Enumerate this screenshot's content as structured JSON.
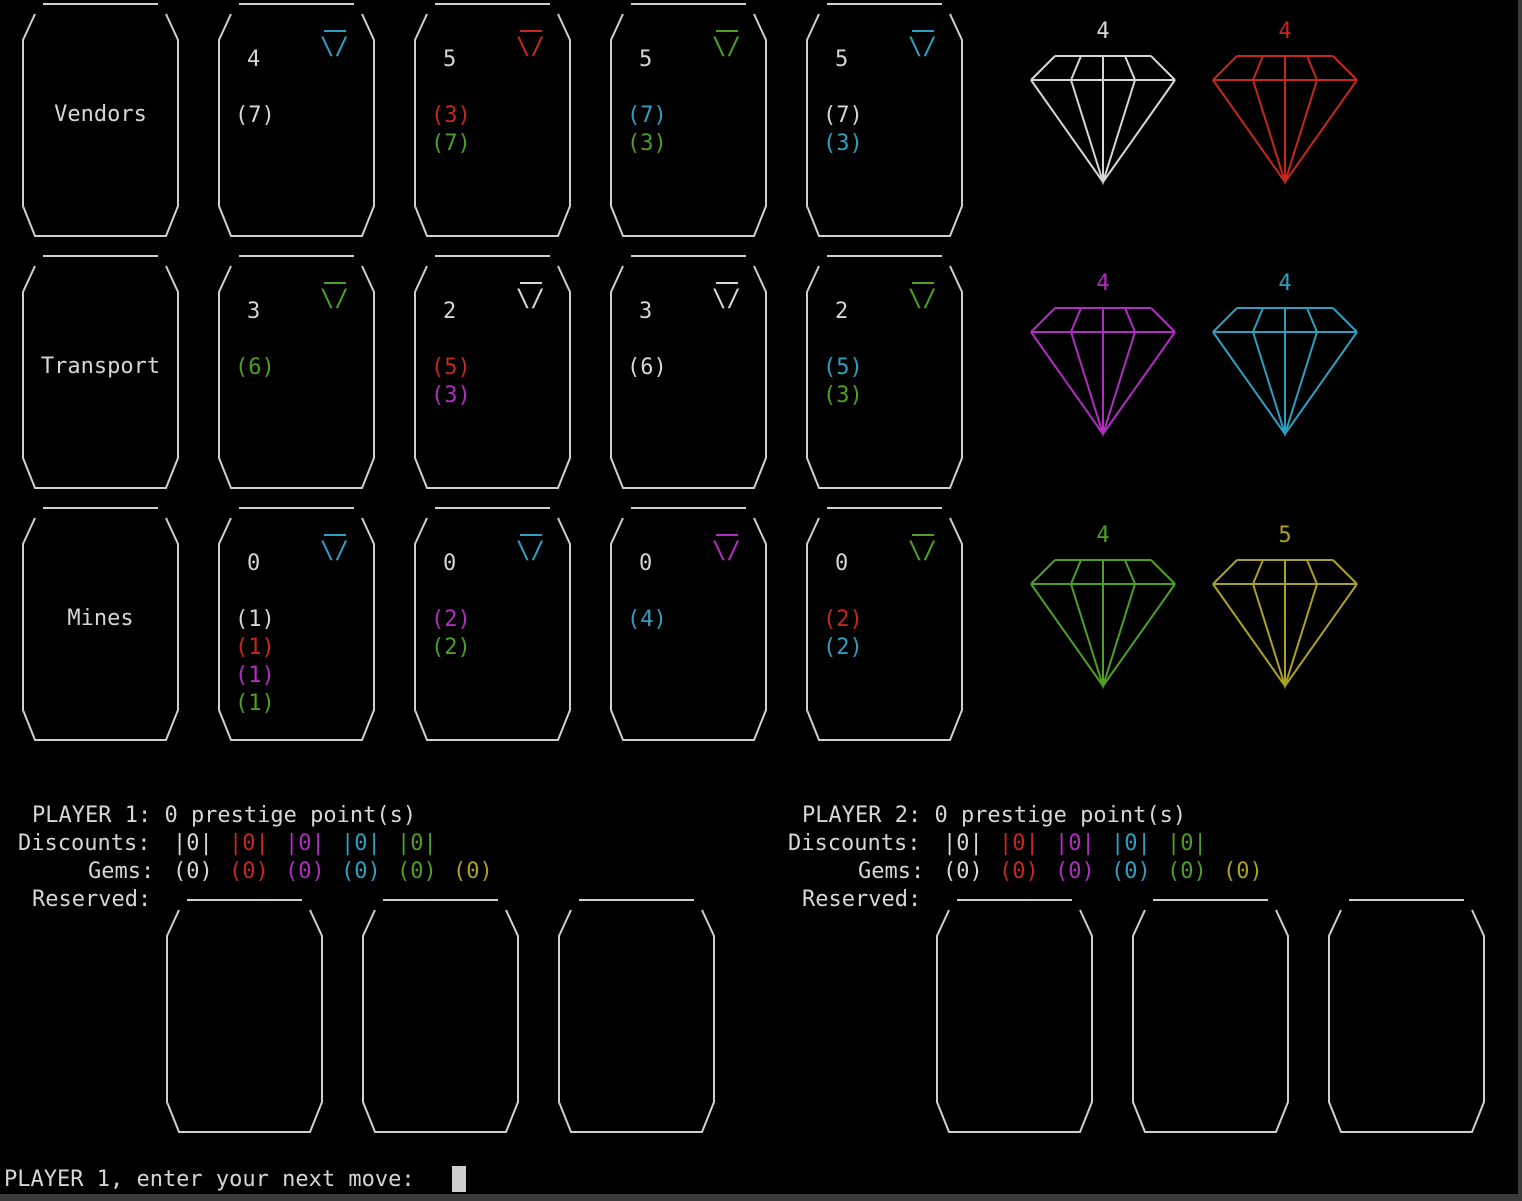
{
  "colors": {
    "white": "#d6d6d6",
    "red": "#c4281f",
    "purple": "#b12dc1",
    "cyan": "#2f9fc0",
    "green": "#4d9f25",
    "yellow": "#aaa126"
  },
  "rows": [
    {
      "label": "Vendors",
      "cards": [
        {
          "points": "4",
          "gem": "cyan",
          "costs": [
            {
              "value": "(7)",
              "color": "white"
            }
          ]
        },
        {
          "points": "5",
          "gem": "red",
          "costs": [
            {
              "value": "(3)",
              "color": "red"
            },
            {
              "value": "(7)",
              "color": "green"
            }
          ]
        },
        {
          "points": "5",
          "gem": "green",
          "costs": [
            {
              "value": "(7)",
              "color": "cyan"
            },
            {
              "value": "(3)",
              "color": "green"
            }
          ]
        },
        {
          "points": "5",
          "gem": "cyan",
          "costs": [
            {
              "value": "(7)",
              "color": "white"
            },
            {
              "value": "(3)",
              "color": "cyan"
            }
          ]
        }
      ]
    },
    {
      "label": "Transport",
      "cards": [
        {
          "points": "3",
          "gem": "green",
          "costs": [
            {
              "value": "(6)",
              "color": "green"
            }
          ]
        },
        {
          "points": "2",
          "gem": "white",
          "costs": [
            {
              "value": "(5)",
              "color": "red"
            },
            {
              "value": "(3)",
              "color": "purple"
            }
          ]
        },
        {
          "points": "3",
          "gem": "white",
          "costs": [
            {
              "value": "(6)",
              "color": "white"
            }
          ]
        },
        {
          "points": "2",
          "gem": "green",
          "costs": [
            {
              "value": "(5)",
              "color": "cyan"
            },
            {
              "value": "(3)",
              "color": "green"
            }
          ]
        }
      ]
    },
    {
      "label": "Mines",
      "cards": [
        {
          "points": "0",
          "gem": "cyan",
          "costs": [
            {
              "value": "(1)",
              "color": "white"
            },
            {
              "value": "(1)",
              "color": "red"
            },
            {
              "value": "(1)",
              "color": "purple"
            },
            {
              "value": "(1)",
              "color": "green"
            }
          ]
        },
        {
          "points": "0",
          "gem": "cyan",
          "costs": [
            {
              "value": "(2)",
              "color": "purple"
            },
            {
              "value": "(2)",
              "color": "green"
            }
          ]
        },
        {
          "points": "0",
          "gem": "purple",
          "costs": [
            {
              "value": "(4)",
              "color": "cyan"
            }
          ]
        },
        {
          "points": "0",
          "gem": "green",
          "costs": [
            {
              "value": "(2)",
              "color": "red"
            },
            {
              "value": "(2)",
              "color": "cyan"
            }
          ]
        }
      ]
    }
  ],
  "gem_bank": [
    {
      "count": "4",
      "color": "white"
    },
    {
      "count": "4",
      "color": "red"
    },
    {
      "count": "4",
      "color": "purple"
    },
    {
      "count": "4",
      "color": "cyan"
    },
    {
      "count": "4",
      "color": "green"
    },
    {
      "count": "5",
      "color": "yellow"
    }
  ],
  "players": [
    {
      "title": "PLAYER 1: 0 prestige point(s)",
      "discounts_label": "Discounts:",
      "discounts": [
        {
          "value": "|0|",
          "color": "white"
        },
        {
          "value": "|0|",
          "color": "red"
        },
        {
          "value": "|0|",
          "color": "purple"
        },
        {
          "value": "|0|",
          "color": "cyan"
        },
        {
          "value": "|0|",
          "color": "green"
        }
      ],
      "gems_label": "Gems:",
      "gems": [
        {
          "value": "(0)",
          "color": "white"
        },
        {
          "value": "(0)",
          "color": "red"
        },
        {
          "value": "(0)",
          "color": "purple"
        },
        {
          "value": "(0)",
          "color": "cyan"
        },
        {
          "value": "(0)",
          "color": "green"
        },
        {
          "value": "(0)",
          "color": "yellow"
        }
      ],
      "reserved_label": "Reserved:"
    },
    {
      "title": "PLAYER 2: 0 prestige point(s)",
      "discounts_label": "Discounts:",
      "discounts": [
        {
          "value": "|0|",
          "color": "white"
        },
        {
          "value": "|0|",
          "color": "red"
        },
        {
          "value": "|0|",
          "color": "purple"
        },
        {
          "value": "|0|",
          "color": "cyan"
        },
        {
          "value": "|0|",
          "color": "green"
        }
      ],
      "gems_label": "Gems:",
      "gems": [
        {
          "value": "(0)",
          "color": "white"
        },
        {
          "value": "(0)",
          "color": "red"
        },
        {
          "value": "(0)",
          "color": "purple"
        },
        {
          "value": "(0)",
          "color": "cyan"
        },
        {
          "value": "(0)",
          "color": "green"
        },
        {
          "value": "(0)",
          "color": "yellow"
        }
      ],
      "reserved_label": "Reserved:"
    }
  ],
  "prompt": "PLAYER 1, enter your next move:"
}
